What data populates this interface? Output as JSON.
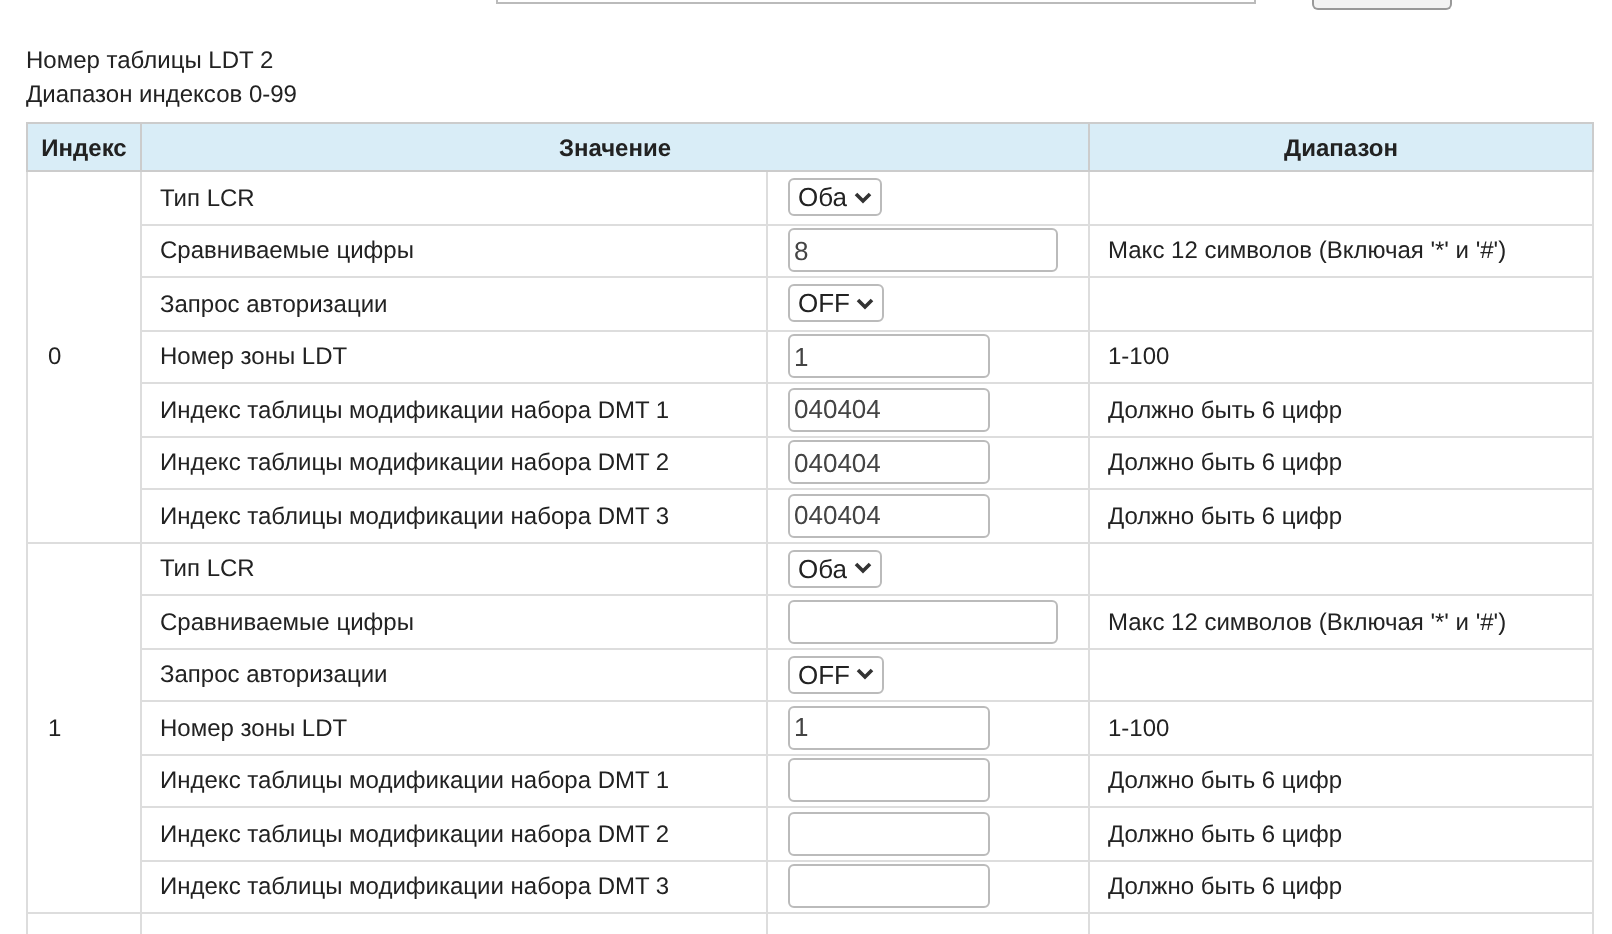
{
  "info": [
    "Номер таблицы LDT 2",
    "Диапазон индексов 0-99"
  ],
  "table": {
    "columns": [
      "Индекс",
      "Значение",
      "Диапазон"
    ],
    "groups": [
      {
        "index": "0",
        "rows": [
          {
            "label": "Тип LCR",
            "kind": "select",
            "value": "Оба"
          },
          {
            "label": "Сравниваемые цифры",
            "kind": "long-text",
            "value": "8",
            "range": "Макс 12 символов (Включая '*' и '#')"
          },
          {
            "label": "Запрос авторизации",
            "kind": "select",
            "value": "OFF"
          },
          {
            "label": "Номер зоны LDT",
            "kind": "short-text",
            "value": "1",
            "range": "1-100"
          },
          {
            "label": "Индекс таблицы модификации набора DMT 1",
            "kind": "short-text",
            "value": "040404",
            "range": "Должно быть 6 цифр"
          },
          {
            "label": "Индекс таблицы модификации набора DMT 2",
            "kind": "short-text",
            "value": "040404",
            "range": "Должно быть 6 цифр"
          },
          {
            "label": "Индекс таблицы модификации набора DMT 3",
            "kind": "short-text",
            "value": "040404",
            "range": "Должно быть 6 цифр"
          }
        ]
      },
      {
        "index": "1",
        "rows": [
          {
            "label": "Тип LCR",
            "kind": "select",
            "value": "Оба"
          },
          {
            "label": "Сравниваемые цифры",
            "kind": "long-text",
            "range": "Макс 12 символов (Включая '*' и '#')"
          },
          {
            "label": "Запрос авторизации",
            "kind": "select",
            "value": "OFF"
          },
          {
            "label": "Номер зоны LDT",
            "kind": "short-text",
            "value": "1",
            "range": "1-100"
          },
          {
            "label": "Индекс таблицы модификации набора DMT 1",
            "kind": "short-text",
            "range": "Должно быть 6 цифр"
          },
          {
            "label": "Индекс таблицы модификации набора DMT 2",
            "kind": "short-text",
            "range": "Должно быть 6 цифр"
          },
          {
            "label": "Индекс таблицы модификации набора DMT 3",
            "kind": "short-text",
            "range": "Должно быть 6 цифр"
          }
        ]
      }
    ]
  }
}
